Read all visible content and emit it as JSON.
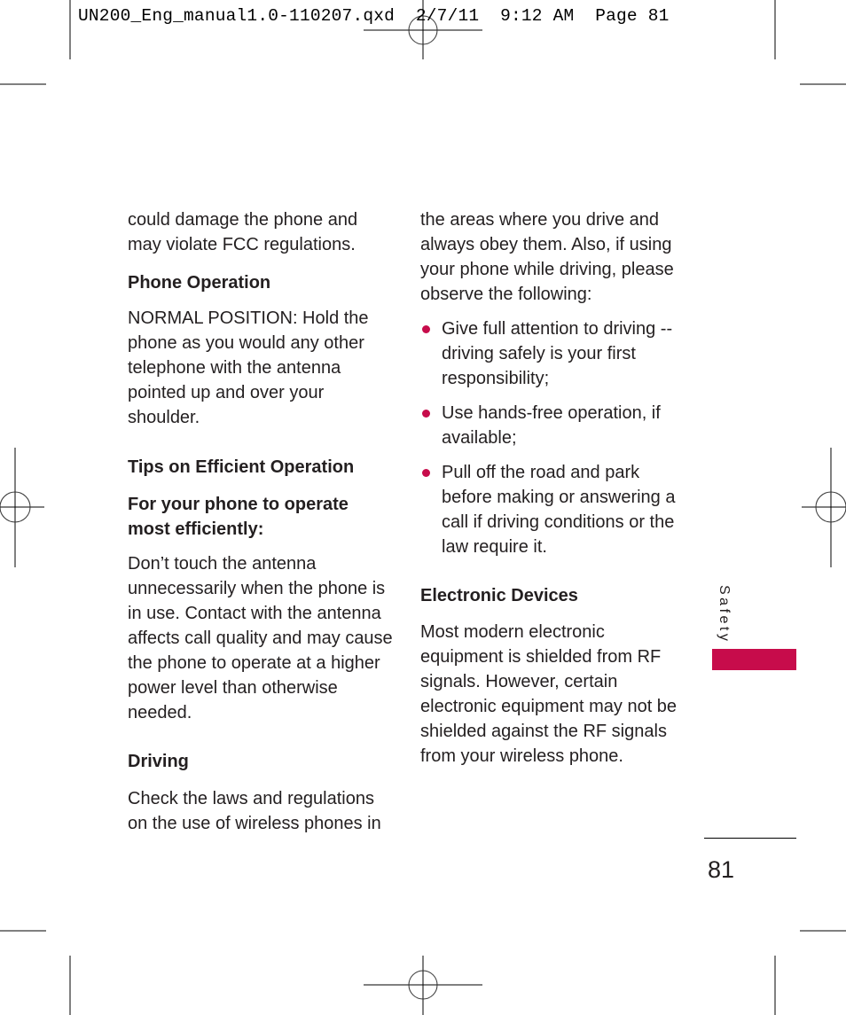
{
  "slug_line": "UN200_Eng_manual1.0-110207.qxd  2/7/11  9:12 AM  Page 81",
  "accent_color": "#c70c4b",
  "left_column": {
    "intro_lines": [
      "could damage the phone and",
      "may violate FCC regulations."
    ],
    "phone_operation": {
      "heading": "Phone Operation",
      "body_lines": [
        "NORMAL POSITION: Hold the",
        "phone as you would any other",
        "telephone with the antenna",
        "pointed up and over your",
        "shoulder."
      ]
    },
    "tips": {
      "heading": "Tips on Efficient Operation",
      "subheading_lines": [
        "For your phone to operate",
        "most efficiently:"
      ],
      "body_lines": [
        "Don’t touch the antenna",
        "unnecessarily when the phone is",
        "in use. Contact with the antenna",
        "affects call quality and may cause",
        "the phone to operate at a higher",
        "power level than otherwise",
        "needed."
      ]
    },
    "driving": {
      "heading": "Driving",
      "body_lines": [
        "Check the laws and regulations",
        "on the use of wireless phones in"
      ]
    }
  },
  "right_column": {
    "intro_lines": [
      "the areas where you drive and",
      "always obey them. Also, if using",
      "your phone while driving, please",
      "observe the following:"
    ],
    "bullets": [
      {
        "lines": [
          "Give full attention to driving --",
          "driving safely is your first",
          "responsibility;"
        ]
      },
      {
        "lines": [
          "Use hands-free operation, if",
          "available;"
        ]
      },
      {
        "lines": [
          "Pull off the road and park",
          "before making or answering a",
          "call if driving conditions or the",
          "law require it."
        ]
      }
    ],
    "electronic_devices": {
      "heading": "Electronic Devices",
      "body_lines": [
        "Most modern electronic",
        "equipment is shielded from RF",
        "signals. However, certain",
        "electronic equipment may not be",
        "shielded against the RF signals",
        "from your wireless phone."
      ]
    }
  },
  "section_tab_label": "Safety",
  "page_number": "81"
}
